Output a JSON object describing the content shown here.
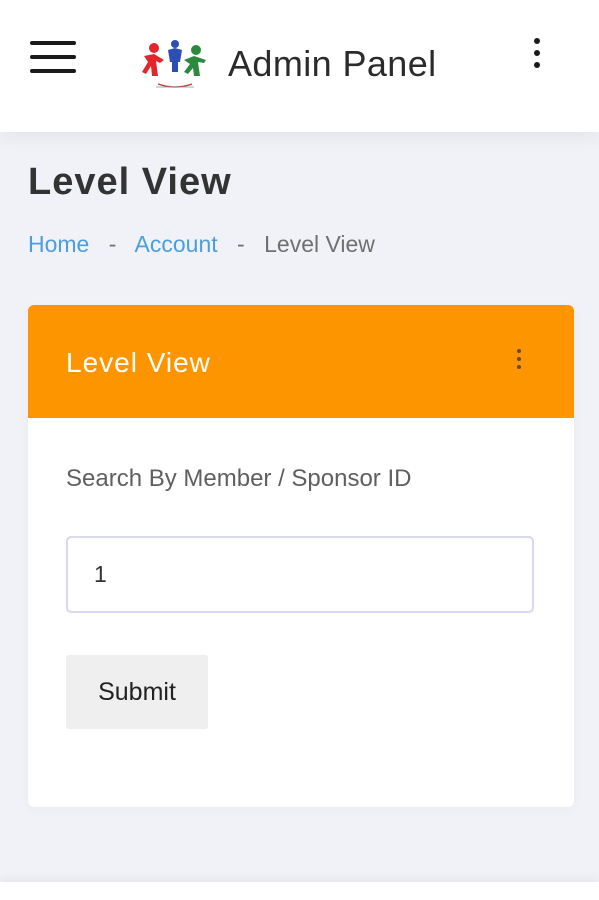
{
  "header": {
    "menu_icon": "hamburger-menu-icon",
    "logo_icon": "people-logo-icon",
    "brand": "Admin Panel",
    "more_icon": "vertical-dots-icon"
  },
  "page": {
    "title": "Level View"
  },
  "breadcrumb": {
    "items": [
      "Home",
      "Account",
      "Level View"
    ],
    "separator": "-"
  },
  "card": {
    "title": "Level View",
    "header_color": "#fd9500",
    "more_icon": "vertical-dots-icon",
    "search_label": "Search By Member / Sponsor ID",
    "search_value": "1",
    "submit_label": "Submit"
  },
  "colors": {
    "accent": "#fd9500",
    "link": "#4a9fe0",
    "background": "#f1f2f7"
  }
}
